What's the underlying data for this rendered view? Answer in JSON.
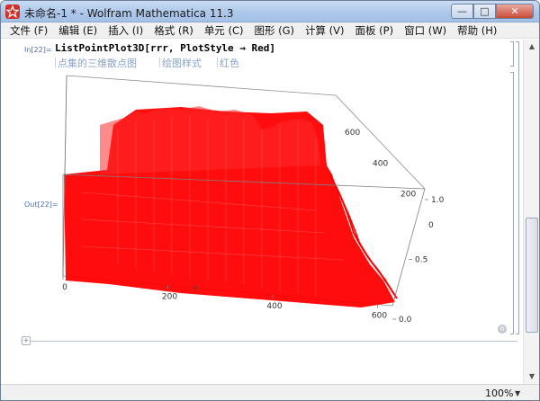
{
  "window": {
    "title": "未命名-1 * - Wolfram Mathematica 11.3",
    "min_glyph": "—",
    "max_glyph": "□",
    "close_glyph": "✕"
  },
  "menu": [
    {
      "label": "文件 (F)"
    },
    {
      "label": "编辑 (E)"
    },
    {
      "label": "插入 (I)"
    },
    {
      "label": "格式 (R)"
    },
    {
      "label": "单元 (C)"
    },
    {
      "label": "图形 (G)"
    },
    {
      "label": "计算 (V)"
    },
    {
      "label": "面板 (P)"
    },
    {
      "label": "窗口 (W)"
    },
    {
      "label": "帮助 (H)"
    }
  ],
  "cell": {
    "in_label": "In[22]=",
    "out_label": "Out[22]=",
    "input_func": "ListPointPlot3D",
    "input_args": "[rrr, PlotStyle → Red]",
    "hints": [
      "点集的三维散点图",
      "绘图样式",
      "红色"
    ]
  },
  "plot": {
    "point_color": "#ff0000",
    "frame_color": "#7f7f7f",
    "x_ticks": [
      "0",
      "200",
      "400",
      "600"
    ],
    "y_ticks": [
      "0",
      "200",
      "400",
      "600"
    ],
    "z_ticks": [
      "0.0",
      "0.5",
      "1.0"
    ]
  },
  "status": {
    "zoom": "100%",
    "zoom_arrow": "▼"
  },
  "icons": {
    "plus": "+",
    "gear": "⚙",
    "scroll_up": "▲",
    "scroll_down": "▼"
  }
}
